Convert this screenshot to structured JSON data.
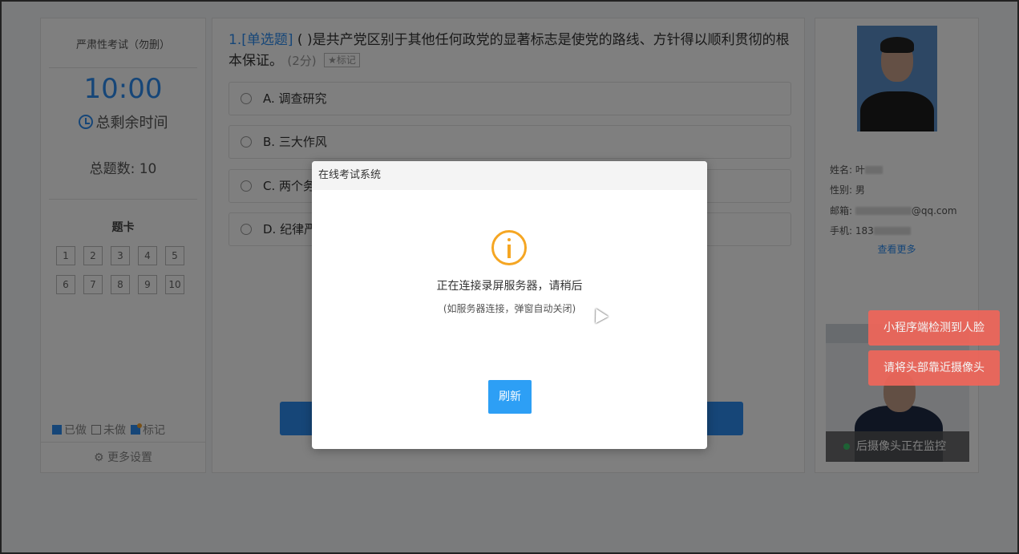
{
  "left": {
    "exam_title": "严肃性考试（勿删）",
    "timer": "10:00",
    "timer_label": "总剩余时间",
    "total_questions": "总题数: 10",
    "card_title": "题卡",
    "cards": [
      "1",
      "2",
      "3",
      "4",
      "5",
      "6",
      "7",
      "8",
      "9",
      "10"
    ],
    "legend_done": "已做",
    "legend_undone": "未做",
    "legend_mark": "标记",
    "more_settings": "更多设置"
  },
  "question": {
    "number": "1.",
    "type": "[单选题]",
    "text": "(  )是共产党区别于其他任何政党的显著标志是使党的路线、方针得以顺利贯彻的根本保证。",
    "score": "(2分)",
    "mark": "★标记",
    "options": [
      "A. 调查研究",
      "B. 三大作风",
      "C. 两个务",
      "D. 纪律严"
    ]
  },
  "right": {
    "name_label": "姓名:",
    "name_value": "叶",
    "gender_label": "性别:",
    "gender_value": "男",
    "email_label": "邮箱:",
    "email_value": "@qq.com",
    "phone_label": "手机:",
    "phone_value": "183",
    "see_more": "查看更多",
    "camera_status": "后摄像头正在监控"
  },
  "toasts": [
    "小程序端检测到人脸",
    "请将头部靠近摄像头"
  ],
  "modal": {
    "title": "在线考试系统",
    "message": "正在连接录屏服务器，请稍后",
    "sub": "(如服务器连接，弹窗自动关闭)",
    "refresh": "刷新"
  },
  "colors": {
    "accent": "#2d8cf0",
    "warning": "#f5a623",
    "toast": "#f0665a"
  }
}
